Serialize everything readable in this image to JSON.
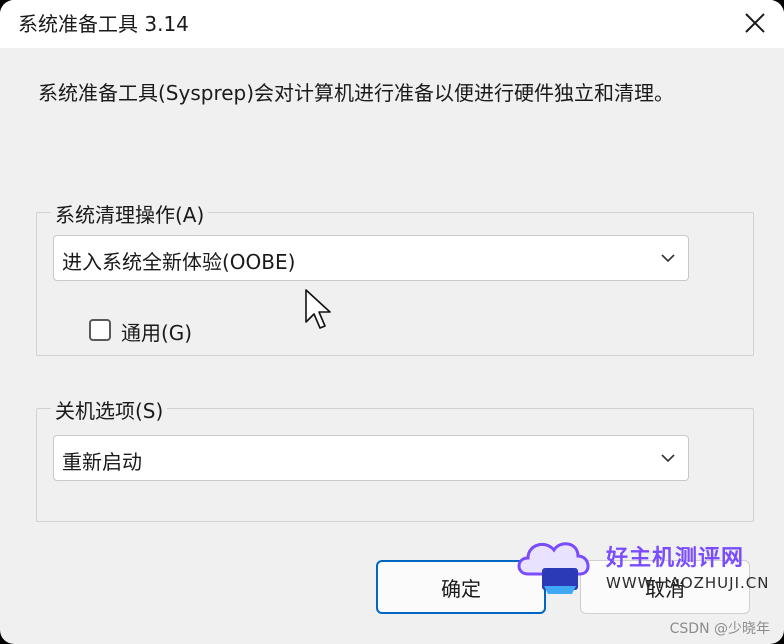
{
  "window": {
    "title": "系统准备工具 3.14",
    "close_icon": "close-icon"
  },
  "description": "系统准备工具(Sysprep)会对计算机进行准备以便进行硬件独立和清理。",
  "cleanup_group": {
    "title": "系统清理操作(A)",
    "selected": "进入系统全新体验(OOBE)",
    "generalize_label": "通用(G)",
    "generalize_checked": false
  },
  "shutdown_group": {
    "title": "关机选项(S)",
    "selected": "重新启动"
  },
  "buttons": {
    "ok": "确定",
    "cancel": "取消"
  },
  "watermark": {
    "line1": "好主机测评网",
    "line2": "WWW.HAOZHUJI.CN"
  },
  "credit": "CSDN @少晓年",
  "colors": {
    "accent": "#0067c0",
    "watermark": "#7a4cff"
  }
}
